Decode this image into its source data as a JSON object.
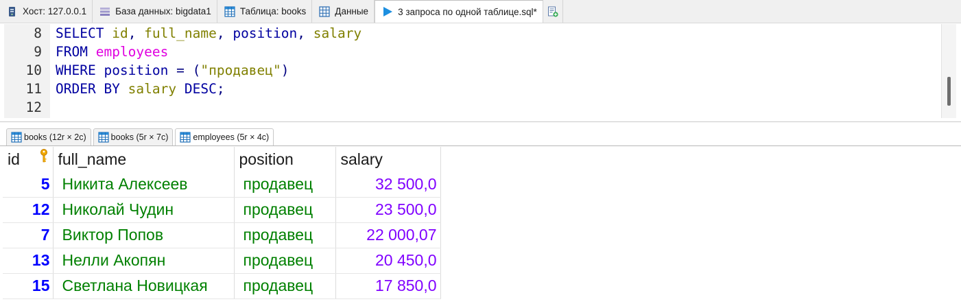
{
  "top_tabs": [
    {
      "label": "Хост: 127.0.0.1",
      "icon": "server-icon"
    },
    {
      "label": "База данных: bigdata1",
      "icon": "database-icon"
    },
    {
      "label": "Таблица: books",
      "icon": "table-icon"
    },
    {
      "label": "Данные",
      "icon": "grid-icon"
    },
    {
      "label": "3 запроса по одной таблице.sql*",
      "icon": "play-icon",
      "active": true
    },
    {
      "label": "",
      "icon": "new-query-icon"
    }
  ],
  "editor": {
    "line_numbers": [
      "8",
      "9",
      "10",
      "11",
      "12"
    ],
    "lines": [
      [
        "SELECT",
        " ",
        "id",
        ", ",
        "full_name",
        ", ",
        "position",
        ", ",
        "salary"
      ],
      [
        "FROM",
        " ",
        "employees"
      ],
      [
        "WHERE",
        " ",
        "position",
        " = (",
        "\"продавец\"",
        ")"
      ],
      [
        "ORDER BY",
        " ",
        "salary",
        " ",
        "DESC",
        ";"
      ],
      []
    ]
  },
  "result_tabs": [
    {
      "label": "books (12r × 2c)"
    },
    {
      "label": "books (5r × 7c)"
    },
    {
      "label": "employees (5r × 4c)",
      "active": true
    }
  ],
  "grid": {
    "columns": [
      "id",
      "full_name",
      "position",
      "salary"
    ],
    "rows": [
      [
        "5",
        "Никита Алексеев",
        "продавец",
        "32 500,0"
      ],
      [
        "12",
        "Николай Чудин",
        "продавец",
        "23 500,0"
      ],
      [
        "7",
        "Виктор Попов",
        "продавец",
        "22 000,07"
      ],
      [
        "13",
        "Нелли Акопян",
        "продавец",
        "20 450,0"
      ],
      [
        "15",
        "Светлана Новицкая",
        "продавец",
        "17 850,0"
      ]
    ]
  },
  "colors": {
    "keyword": "#0000a0",
    "table_name": "#e000e0",
    "string": "#808000",
    "id_value": "#0000ff",
    "text_value": "#008000",
    "number_value": "#8000ff"
  }
}
